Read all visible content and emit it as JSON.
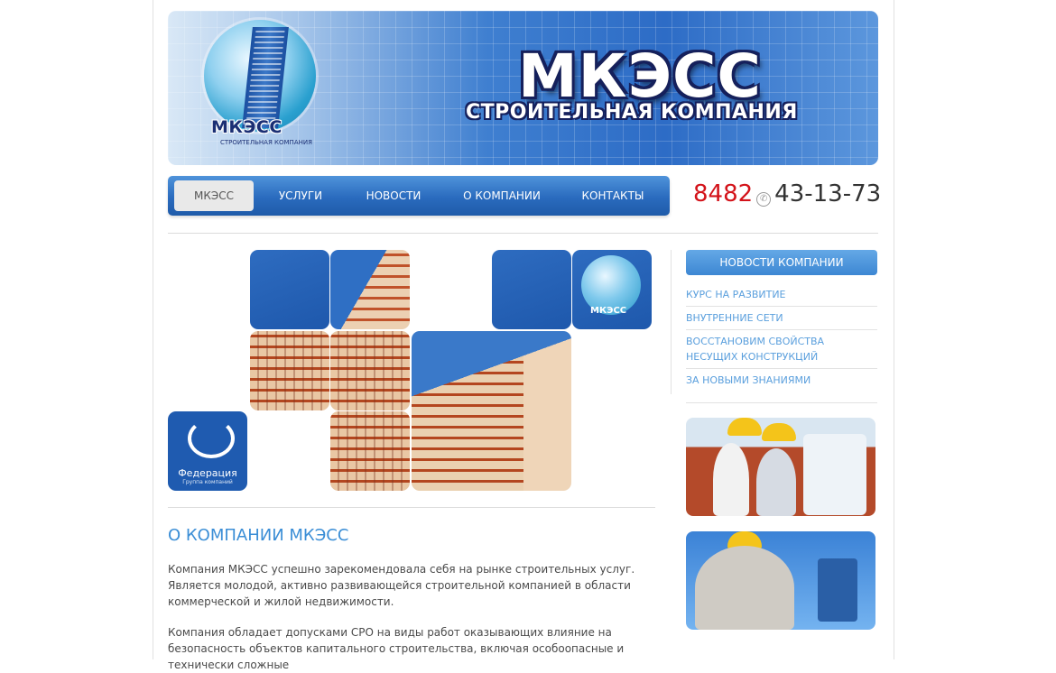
{
  "header": {
    "brand": "МКЭСС",
    "tagline": "СТРОИТЕЛЬНАЯ КОМПАНИЯ",
    "logo_word": "МКЭСС",
    "logo_sub": "СТРОИТЕЛЬНАЯ КОМПАНИЯ"
  },
  "nav": {
    "items": [
      {
        "label": "МКЭСС"
      },
      {
        "label": "УСЛУГИ"
      },
      {
        "label": "НОВОСТИ"
      },
      {
        "label": "О КОМПАНИИ"
      },
      {
        "label": "КОНТАКТЫ"
      }
    ],
    "active_index": 0
  },
  "phone": {
    "code": "8482",
    "number": "43-13-73"
  },
  "mosaic": {
    "federation_name": "Федерация",
    "federation_sub": "Группа компаний",
    "mini_logo_word": "МКЭСС"
  },
  "about": {
    "title": "О КОМПАНИИ МКЭСС",
    "paragraph1": "Компания МКЭСС успешно зарекомендовала себя на рынке строительных услуг. Является молодой, активно развивающейся строительной компанией в области коммерческой и жилой недвижимости.",
    "paragraph2": "Компания обладает допусками СРО на виды работ оказывающих влияние на безопасность объектов капитального строительства, включая особоопасные и технически сложные"
  },
  "sidebar": {
    "news_title": "НОВОСТИ КОМПАНИИ",
    "news": [
      "КУРС НА РАЗВИТИЕ",
      "ВНУТРЕННИЕ СЕТИ",
      "ВОССТАНОВИМ СВОЙСТВА НЕСУЩИХ КОНСТРУКЦИЙ",
      "ЗА НОВЫМИ ЗНАНИЯМИ"
    ]
  },
  "colors": {
    "accent_blue": "#3b8ed6",
    "nav_blue": "#2a6bbe",
    "phone_code_red": "#d3131a"
  }
}
